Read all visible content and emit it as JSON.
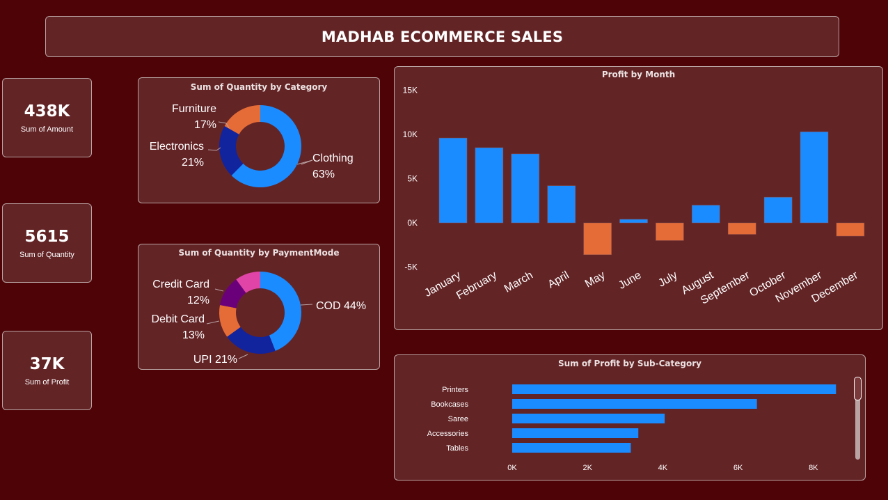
{
  "title": "MADHAB ECOMMERCE SALES",
  "kpis": {
    "amount": {
      "value": "438K",
      "label": "Sum of Amount"
    },
    "quantity": {
      "value": "5615",
      "label": "Sum of Quantity"
    },
    "profit": {
      "value": "37K",
      "label": "Sum of Profit"
    }
  },
  "colors": {
    "background": "#4e0407",
    "card": "#632426",
    "blue": "#1a8cff",
    "navy": "#12239e",
    "orange": "#e66c37",
    "purple": "#6b007b",
    "pink": "#e044a7"
  },
  "chart_data": [
    {
      "type": "pie",
      "title": "Sum of Quantity by Category",
      "slices": [
        {
          "label": "Clothing",
          "percent": 63,
          "pct_text": "63%",
          "color": "#1a8cff"
        },
        {
          "label": "Electronics",
          "percent": 21,
          "pct_text": "21%",
          "color": "#12239e"
        },
        {
          "label": "Furniture",
          "percent": 17,
          "pct_text": "17%",
          "color": "#e66c37"
        }
      ]
    },
    {
      "type": "pie",
      "title": "Sum of Quantity by PaymentMode",
      "slices": [
        {
          "label": "COD",
          "percent": 44,
          "pct_text": "44%",
          "color": "#1a8cff"
        },
        {
          "label": "UPI",
          "percent": 21,
          "pct_text": "21%",
          "color": "#12239e"
        },
        {
          "label": "Debit Card",
          "percent": 13,
          "pct_text": "13%",
          "color": "#e66c37"
        },
        {
          "label": "Credit Card",
          "percent": 12,
          "pct_text": "12%",
          "color": "#6b007b"
        },
        {
          "label": "",
          "percent": 10,
          "pct_text": "",
          "color": "#e044a7"
        }
      ]
    },
    {
      "type": "bar",
      "title": "Profit by Month",
      "categories": [
        "January",
        "February",
        "March",
        "April",
        "May",
        "June",
        "July",
        "August",
        "September",
        "October",
        "November",
        "December"
      ],
      "values": [
        9600,
        8500,
        7800,
        4200,
        -3600,
        400,
        -2000,
        2000,
        -1300,
        2900,
        10300,
        -1500
      ],
      "ylim": [
        -5000,
        15000
      ],
      "yticks": [
        {
          "v": 15000,
          "t": "15K"
        },
        {
          "v": 10000,
          "t": "10K"
        },
        {
          "v": 5000,
          "t": "5K"
        },
        {
          "v": 0,
          "t": "0K"
        },
        {
          "v": -5000,
          "t": "-5K"
        }
      ],
      "positive_color": "#1a8cff",
      "negative_color": "#e66c37"
    },
    {
      "type": "bar",
      "orientation": "horizontal",
      "title": "Sum of Profit by Sub-Category",
      "categories": [
        "Printers",
        "Bookcases",
        "Saree",
        "Accessories",
        "Tables"
      ],
      "values": [
        8600,
        6500,
        4050,
        3350,
        3150
      ],
      "xlim": [
        0,
        9000
      ],
      "xticks": [
        {
          "v": 0,
          "t": "0K"
        },
        {
          "v": 2000,
          "t": "2K"
        },
        {
          "v": 4000,
          "t": "4K"
        },
        {
          "v": 6000,
          "t": "6K"
        },
        {
          "v": 8000,
          "t": "8K"
        }
      ],
      "color": "#1a8cff"
    }
  ]
}
